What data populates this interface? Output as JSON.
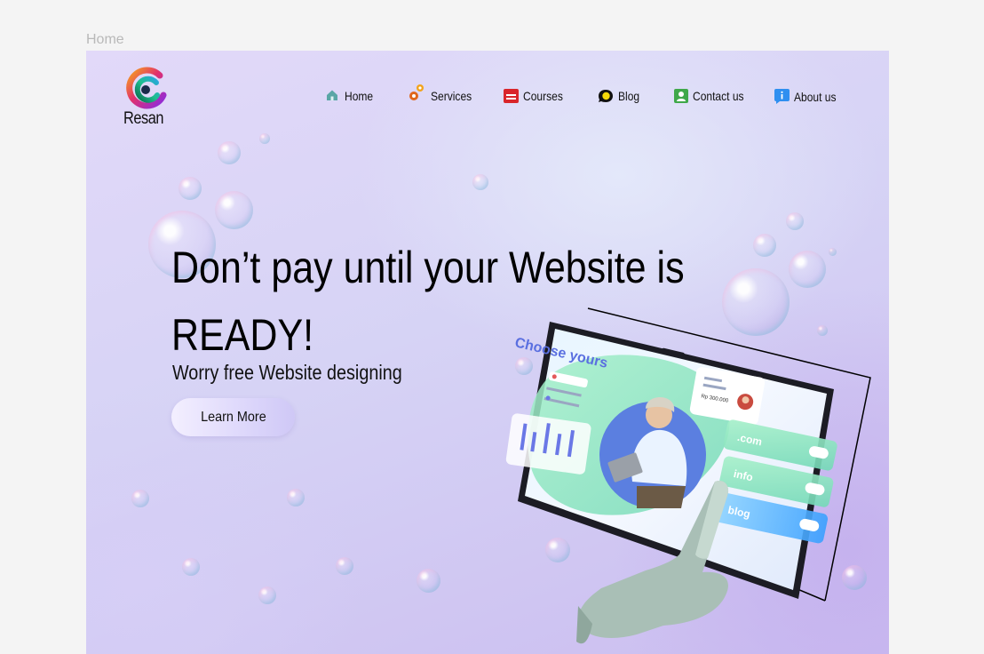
{
  "page_label": "Home",
  "brand": {
    "name": "Resan",
    "colors": {
      "accent": "#d6d3f5",
      "background": "#e2d9f9"
    }
  },
  "nav": {
    "items": [
      {
        "label": "Home",
        "icon": "home-icon"
      },
      {
        "label": "Services",
        "icon": "gears-icon"
      },
      {
        "label": "Courses",
        "icon": "courses-icon"
      },
      {
        "label": "Blog",
        "icon": "blog-chat-icon"
      },
      {
        "label": "Contact us",
        "icon": "contact-icon"
      },
      {
        "label": "About us",
        "icon": "info-icon"
      }
    ]
  },
  "hero": {
    "headline_line1": "Don’t pay until your Website is",
    "headline_line2": "READY!",
    "subtitle": "Worry free Website  designing",
    "cta_label": "Learn More"
  },
  "illustration": {
    "heading": "Choose yours",
    "amount_1": "Rp 300.000",
    "domains": [
      ".com",
      "info",
      "blog"
    ]
  }
}
